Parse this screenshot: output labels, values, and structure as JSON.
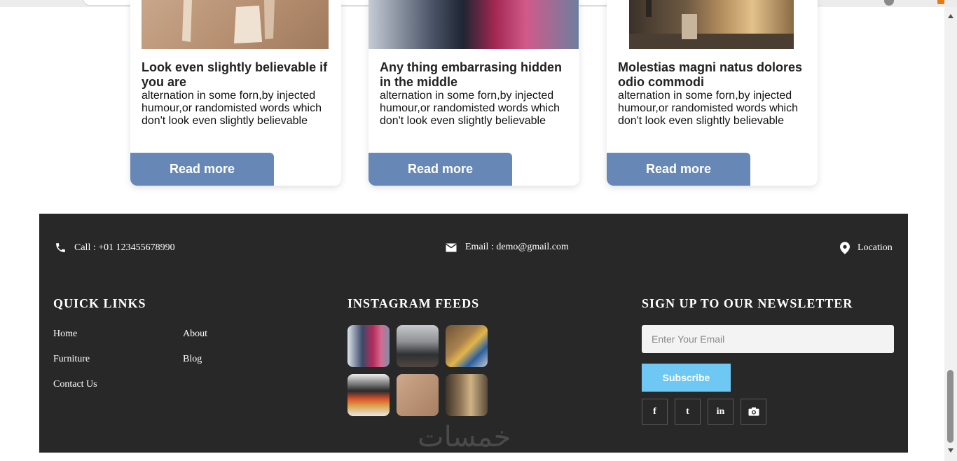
{
  "cards": [
    {
      "title": "Look even slightly believable if you are",
      "text": "alternation in some forn,by injected humour,or randomisted words which don't look even slightly believable",
      "button": "Read more"
    },
    {
      "title": "Any thing embarrasing hidden in the middle",
      "text": "alternation in some forn,by injected humour,or randomisted words which don't look even slightly believable",
      "button": "Read more"
    },
    {
      "title": "Molestias magni natus dolores odio commodi",
      "text": "alternation in some forn,by injected humour,or randomisted words which don't look even slightly believable",
      "button": "Read more"
    }
  ],
  "contact": {
    "phone": "Call : +01 123455678990",
    "email": "Email : demo@gmail.com",
    "location": "Location"
  },
  "quick_links": {
    "heading": "QUICK LINKS",
    "items": [
      "Home",
      "About",
      "Furniture",
      "Blog",
      "Contact Us"
    ]
  },
  "instagram": {
    "heading": "INSTAGRAM FEEDS"
  },
  "newsletter": {
    "heading": "SIGN UP TO OUR NEWSLETTER",
    "placeholder": "Enter Your Email",
    "button": "Subscribe"
  },
  "social": [
    "f",
    "t",
    "in"
  ],
  "icons": {
    "phone": "phone-icon",
    "email": "envelope-icon",
    "location": "map-pin-icon",
    "instagram": "camera-icon"
  },
  "colors": {
    "button": "#6788b6",
    "footer_bg": "#282828",
    "subscribe": "#6fc8f4"
  },
  "watermark": "خمسات"
}
